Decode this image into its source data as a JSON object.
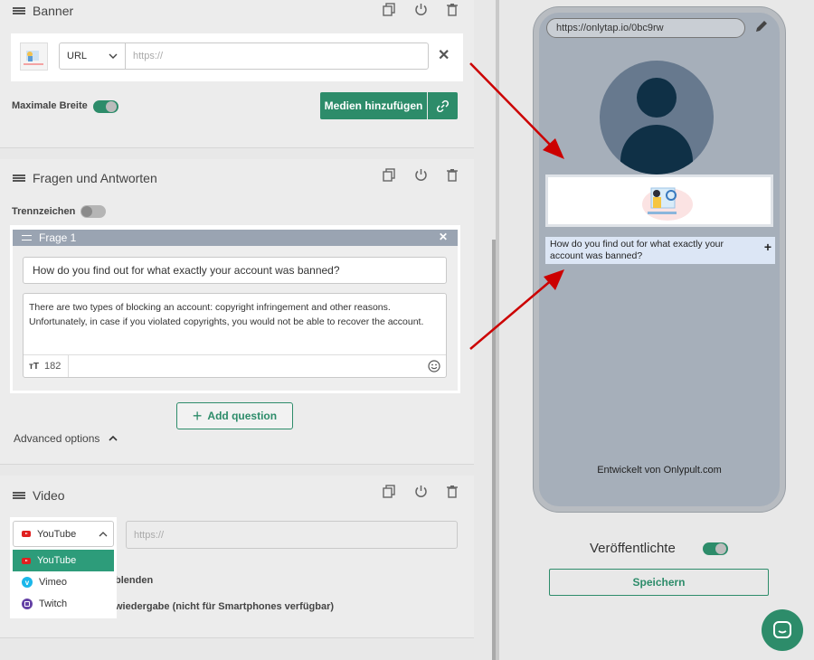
{
  "banner": {
    "title": "Banner",
    "url_type": "URL",
    "url_placeholder": "https://",
    "max_width_label": "Maximale Breite",
    "add_media_label": "Medien hinzufügen"
  },
  "faq": {
    "title": "Fragen und Antworten",
    "separator_label": "Trennzeichen",
    "item_title": "Frage 1",
    "question": "How do you find out for what exactly your account was banned?",
    "answer": "There are two types of blocking an account: copyright infringement and other reasons. Unfortunately, in case if you violated copyrights, you would not be able to recover the account.",
    "char_count": "182",
    "add_question": "Add question",
    "advanced_options": "Advanced options"
  },
  "video": {
    "title": "Video",
    "selected": "YouTube",
    "url_placeholder": "https://",
    "options": [
      "YouTube",
      "Vimeo",
      "Twitch"
    ],
    "option_row1_partial": "blenden",
    "option_row2_partial": "wiedergabe (nicht für Smartphones verfügbar)"
  },
  "preview": {
    "url": "https://onlytap.io/0bc9rw",
    "faq_question": "How do you find out for what exactly your account was banned?",
    "footer": "Entwickelt von Onlypult.com",
    "publish_label": "Veröffentlichte",
    "save_label": "Speichern"
  },
  "colors": {
    "accent": "#2d8c6a",
    "arrow": "#cc0000",
    "phone_screen": "#a6afba",
    "faq_header": "#9aa4b2"
  },
  "icons": [
    "drag-handle-icon",
    "copy-icon",
    "power-icon",
    "trash-icon",
    "close-icon",
    "link-icon",
    "chevron-down-icon",
    "chevron-up-icon",
    "plus-icon",
    "emoji-icon",
    "text-size-icon",
    "pencil-icon",
    "user-avatar-icon",
    "chat-icon",
    "youtube-icon",
    "vimeo-icon",
    "twitch-icon"
  ]
}
